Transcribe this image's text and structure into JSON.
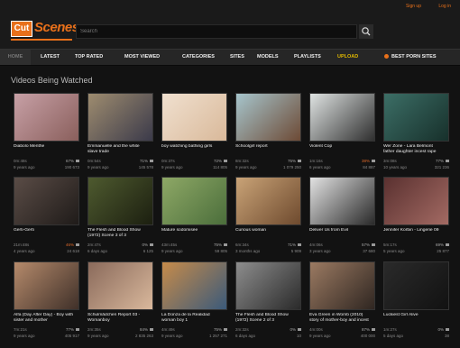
{
  "header": {
    "logo_box": "Cut",
    "logo_word": "Scenes",
    "search_placeholder": "Search",
    "links": [
      "Sign up",
      "Log in"
    ]
  },
  "nav": {
    "items": [
      "Home",
      "Latest",
      "Top Rated",
      "Most Viewed",
      "Categories",
      "Sites",
      "Models",
      "Playlists",
      "Upload",
      "Best Porn Sites"
    ]
  },
  "section_title": "Videos Being Watched",
  "videos": [
    {
      "title": "Diabolo Menthe",
      "duration": "0m:48s",
      "rating": "67%",
      "views": "190 673",
      "age": "9 years ago",
      "colors": [
        "#c7a0a6",
        "#8a5f5c"
      ]
    },
    {
      "title": "Emmanuelle and the white",
      "title2": "slave trade",
      "duration": "0m:54s",
      "rating": "71%",
      "views": "145 578",
      "age": "9 years ago",
      "colors": [
        "#9e8c6f",
        "#3b3a4a"
      ]
    },
    {
      "title": "boy watching bathing girls",
      "duration": "0m:37s",
      "rating": "72%",
      "views": "114 805",
      "age": "9 years ago",
      "colors": [
        "#f0e0cf",
        "#d9b99a"
      ]
    },
    {
      "title": "Schoolgirl report",
      "duration": "8m:32s",
      "rating": "75%",
      "views": "1 079 250",
      "age": "9 years ago",
      "colors": [
        "#a6c5cc",
        "#6d4a35"
      ]
    },
    {
      "title": "Violent Cop",
      "duration": "1m:16s",
      "rating": "38%",
      "views": "84 887",
      "age": "6 years ago",
      "colors": [
        "#dfe3e2",
        "#2f2f2f"
      ]
    },
    {
      "title": "Wer Zone - Lara Belmont",
      "title2": "father daughter incest rape",
      "duration": "3m:08s",
      "rating": "77%",
      "views": "321 236",
      "age": "10 years ago",
      "colors": [
        "#3c6e66",
        "#17302b"
      ]
    },
    {
      "title": "Gerti-Gerti",
      "duration": "21m:48s",
      "rating": "46%",
      "views": "24 618",
      "age": "4 years ago",
      "colors": [
        "#5a4c46",
        "#1f1b19"
      ]
    },
    {
      "title": "The Flesh and Blood Show",
      "title2": "(1972) Scene 3 of 3",
      "duration": "2m:47s",
      "rating": "0%",
      "views": "6 125",
      "age": "6 days ago",
      "colors": [
        "#4e5a2f",
        "#1c1f10"
      ]
    },
    {
      "title": "Mature sodomisée",
      "duration": "43m:45s",
      "rating": "75%",
      "views": "59 805",
      "age": "9 years ago",
      "colors": [
        "#8ea866",
        "#4b6e3b"
      ]
    },
    {
      "title": "Curious woman",
      "duration": "6m:34s",
      "rating": "71%",
      "views": "5 909",
      "age": "3 months ago",
      "colors": [
        "#c9a377",
        "#6e4a2e"
      ]
    },
    {
      "title": "Deliver Us from Evil",
      "duration": "4m:06s",
      "rating": "57%",
      "views": "37 680",
      "age": "3 years ago",
      "colors": [
        "#e2e2e2",
        "#2a2a2a"
      ]
    },
    {
      "title": "Jennifer Korbin - Lingerie 09",
      "duration": "5m:17s",
      "rating": "69%",
      "views": "25 877",
      "age": "5 years ago",
      "colors": [
        "#5a3130",
        "#a36a63"
      ]
    },
    {
      "title": "Alfa (Day After Day) - Boy with",
      "title2": "sister and mother",
      "duration": "7m:21s",
      "rating": "77%",
      "views": "405 917",
      "age": "9 years ago",
      "colors": [
        "#b58a6b",
        "#3f3029"
      ]
    },
    {
      "title": "Schulmädchen Report 03 -",
      "title2": "Womanboy",
      "duration": "2m:35s",
      "rating": "84%",
      "views": "2 835 263",
      "age": "9 years ago",
      "colors": [
        "#8a6a5b",
        "#d9b89c"
      ]
    },
    {
      "title": "La Donza de la Realidad",
      "title2": "woman boy 1",
      "duration": "4m:49s",
      "rating": "75%",
      "views": "1 257 271",
      "age": "9 years ago",
      "colors": [
        "#c68b4a",
        "#3b5a7a"
      ]
    },
    {
      "title": "The Flesh and Blood Show",
      "title2": "(1972) Scene 2 of 3",
      "duration": "2m:32s",
      "rating": "0%",
      "views": "10",
      "age": "6 days ago",
      "colors": [
        "#8d8d8d",
        "#2a2a2a"
      ]
    },
    {
      "title": "Eva Green in Womb (2010)",
      "title2": "story of mother-boy and incest",
      "duration": "4m:00s",
      "rating": "87%",
      "views": "400 000",
      "age": "9 years ago",
      "colors": [
        "#9b7a62",
        "#2f2621"
      ]
    },
    {
      "title": "Luckiest Girl Alive",
      "duration": "1m:27s",
      "rating": "0%",
      "views": "38",
      "age": "5 days ago",
      "colors": [
        "#2a2a2a",
        "#121212"
      ]
    }
  ]
}
